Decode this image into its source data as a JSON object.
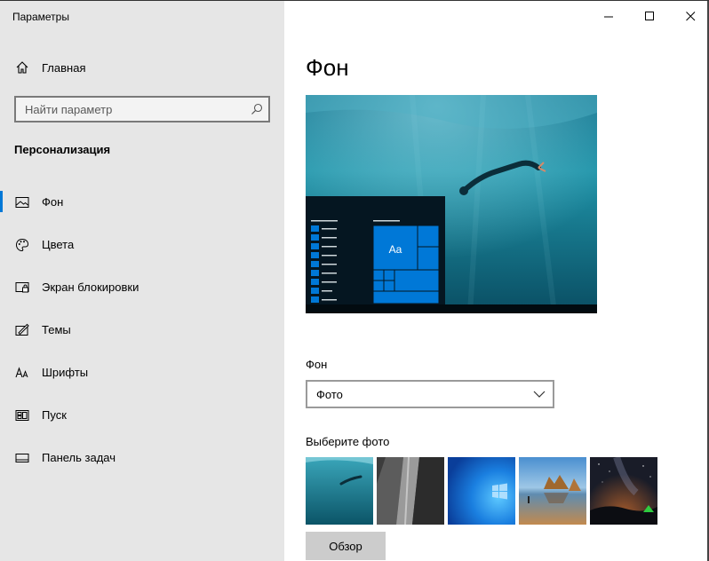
{
  "window": {
    "title": "Параметры",
    "controls": [
      "minimize-icon",
      "maximize-icon",
      "close-icon"
    ]
  },
  "sidebar": {
    "home_label": "Главная",
    "home_icon": "home-icon",
    "search_placeholder": "Найти параметр",
    "search_icon": "search-icon",
    "section_title": "Персонализация",
    "items": [
      {
        "label": "Фон",
        "icon": "picture-icon",
        "selected": true
      },
      {
        "label": "Цвета",
        "icon": "palette-icon",
        "selected": false
      },
      {
        "label": "Экран блокировки",
        "icon": "lock-screen-icon",
        "selected": false
      },
      {
        "label": "Темы",
        "icon": "themes-icon",
        "selected": false
      },
      {
        "label": "Шрифты",
        "icon": "fonts-icon",
        "selected": false
      },
      {
        "label": "Пуск",
        "icon": "start-icon",
        "selected": false
      },
      {
        "label": "Панель задач",
        "icon": "taskbar-icon",
        "selected": false
      }
    ]
  },
  "main": {
    "title": "Фон",
    "preview": {
      "tile_label": "Aa"
    },
    "background_label": "Фон",
    "background_value": "Фото",
    "choose_label": "Выберите фото",
    "photos": [
      "underwater",
      "waterfall-rock",
      "windows-blue",
      "beach-rocks",
      "night-sky-tent"
    ],
    "browse_label": "Обзор"
  },
  "colors": {
    "accent": "#0078d7",
    "sidebar_bg": "#e6e6e6"
  }
}
